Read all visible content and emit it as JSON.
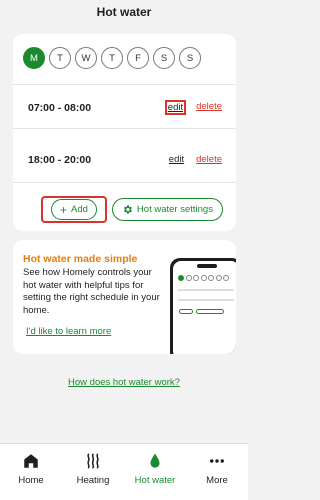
{
  "header": {
    "title": "Hot water"
  },
  "schedule": {
    "days": [
      "M",
      "T",
      "W",
      "T",
      "F",
      "S",
      "S"
    ],
    "active_day_index": 0,
    "slots": [
      {
        "time": "07:00 - 08:00",
        "edit": "edit",
        "delete": "delete"
      },
      {
        "time": "18:00 - 20:00",
        "edit": "edit",
        "delete": "delete"
      }
    ],
    "add_label": "Add",
    "settings_label": "Hot water settings"
  },
  "promo": {
    "title": "Hot water made simple",
    "text": "See how Homely controls your hot water with helpful tips for setting the right schedule in your home.",
    "link": "I'd like to learn more"
  },
  "help_link": "How does hot water work?",
  "tabs": [
    {
      "label": "Home",
      "icon": "home-icon"
    },
    {
      "label": "Heating",
      "icon": "heat-waves-icon"
    },
    {
      "label": "Hot water",
      "icon": "water-drop-icon",
      "active": true
    },
    {
      "label": "More",
      "icon": "more-dots-icon"
    }
  ],
  "colors": {
    "accent": "#1b8a2e",
    "danger": "#d9342b",
    "promo_title": "#e57c0f",
    "background": "#f2f2f2"
  }
}
